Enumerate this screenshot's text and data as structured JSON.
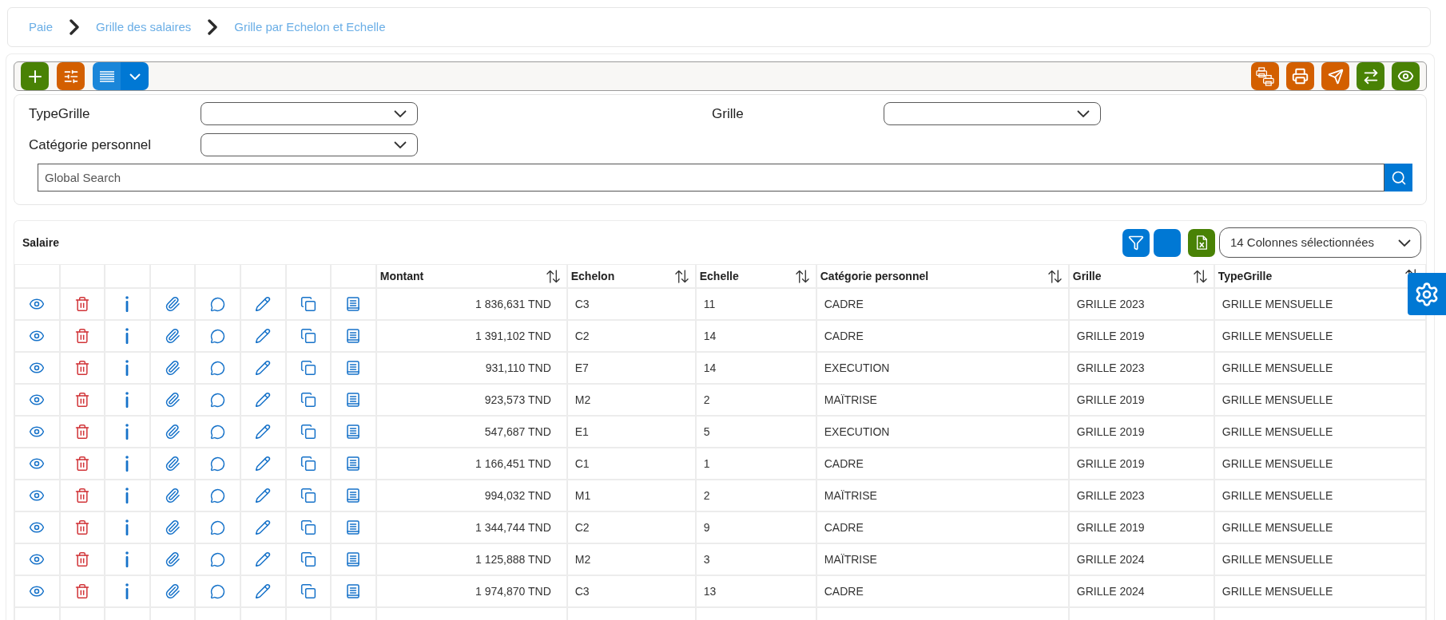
{
  "breadcrumb": [
    {
      "label": "Paie"
    },
    {
      "label": "Grille des salaires"
    },
    {
      "label": "Grille par Echelon et Echelle"
    }
  ],
  "filters": [
    {
      "label": "TypeGrille"
    },
    {
      "label": "Grille"
    },
    {
      "label": "Catégorie personnel"
    }
  ],
  "search": {
    "placeholder": "Global Search"
  },
  "table": {
    "title": "Salaire",
    "column_selector": "14 Colonnes sélectionnées",
    "columns": [
      {
        "label": "Montant",
        "kind": "amount"
      },
      {
        "label": "Echelon",
        "kind": "text"
      },
      {
        "label": "Echelle",
        "kind": "text"
      },
      {
        "label": "Catégorie personnel",
        "kind": "text"
      },
      {
        "label": "Grille",
        "kind": "text"
      },
      {
        "label": "TypeGrille",
        "kind": "text"
      }
    ],
    "rows": [
      {
        "cells": [
          "1 836,631 TND",
          "C3",
          "11",
          "CADRE",
          "GRILLE 2023",
          "GRILLE MENSUELLE"
        ]
      },
      {
        "cells": [
          "1 391,102 TND",
          "C2",
          "14",
          "CADRE",
          "GRILLE 2019",
          "GRILLE MENSUELLE"
        ]
      },
      {
        "cells": [
          "931,110 TND",
          "E7",
          "14",
          "EXECUTION",
          "GRILLE 2023",
          "GRILLE MENSUELLE"
        ]
      },
      {
        "cells": [
          "923,573 TND",
          "M2",
          "2",
          "MAÏTRISE",
          "GRILLE 2019",
          "GRILLE MENSUELLE"
        ]
      },
      {
        "cells": [
          "547,687 TND",
          "E1",
          "5",
          "EXECUTION",
          "GRILLE 2019",
          "GRILLE MENSUELLE"
        ]
      },
      {
        "cells": [
          "1 166,451 TND",
          "C1",
          "1",
          "CADRE",
          "GRILLE 2019",
          "GRILLE MENSUELLE"
        ]
      },
      {
        "cells": [
          "994,032 TND",
          "M1",
          "2",
          "MAÏTRISE",
          "GRILLE 2023",
          "GRILLE MENSUELLE"
        ]
      },
      {
        "cells": [
          "1 344,744 TND",
          "C2",
          "9",
          "CADRE",
          "GRILLE 2019",
          "GRILLE MENSUELLE"
        ]
      },
      {
        "cells": [
          "1 125,888 TND",
          "M2",
          "3",
          "MAÏTRISE",
          "GRILLE 2024",
          "GRILLE MENSUELLE"
        ]
      },
      {
        "cells": [
          "1 974,870 TND",
          "C3",
          "13",
          "CADRE",
          "GRILLE 2024",
          "GRILLE MENSUELLE"
        ]
      }
    ]
  }
}
